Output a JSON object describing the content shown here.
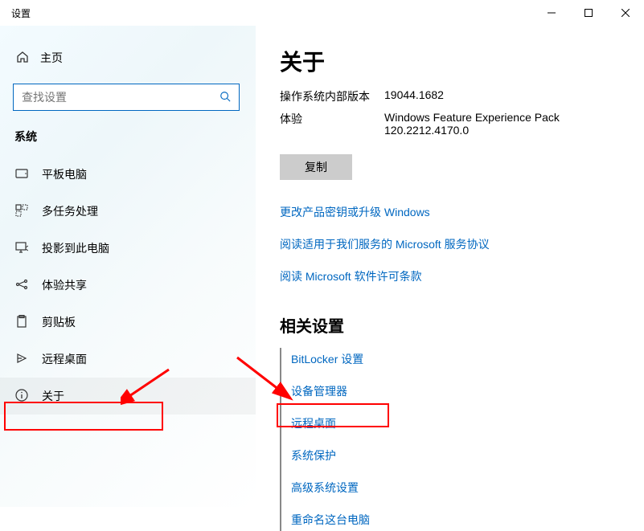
{
  "titlebar": {
    "title": "设置"
  },
  "sidebar": {
    "home": "主页",
    "search_placeholder": "查找设置",
    "section": "系统",
    "items": [
      {
        "label": "平板电脑"
      },
      {
        "label": "多任务处理"
      },
      {
        "label": "投影到此电脑"
      },
      {
        "label": "体验共享"
      },
      {
        "label": "剪贴板"
      },
      {
        "label": "远程桌面"
      },
      {
        "label": "关于"
      }
    ]
  },
  "main": {
    "title": "关于",
    "os_build_label": "操作系统内部版本",
    "os_build_value": "19044.1682",
    "experience_label": "体验",
    "experience_value": "Windows Feature Experience Pack 120.2212.4170.0",
    "copy_button": "复制",
    "links": [
      "更改产品密钥或升级 Windows",
      "阅读适用于我们服务的 Microsoft 服务协议",
      "阅读 Microsoft 软件许可条款"
    ],
    "related_title": "相关设置",
    "related_links": [
      "BitLocker 设置",
      "设备管理器",
      "远程桌面",
      "系统保护",
      "高级系统设置",
      "重命名这台电脑"
    ]
  }
}
